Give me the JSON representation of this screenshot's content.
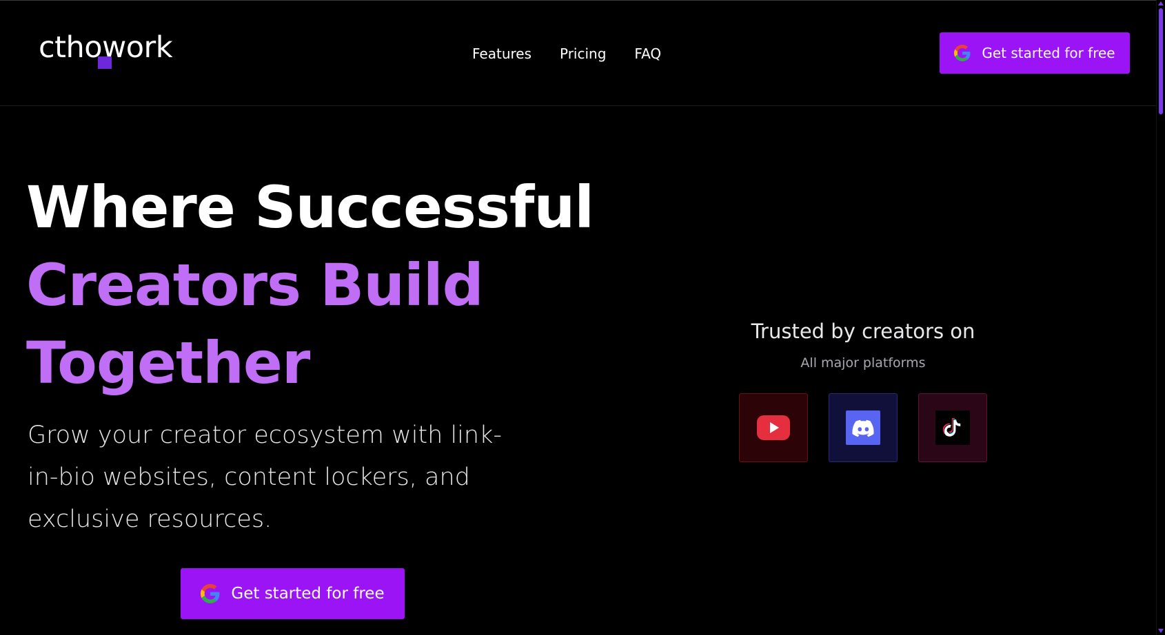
{
  "brand": {
    "logo_text": "cthowork",
    "accent_color": "#9b14f5",
    "highlight_color": "#c06ef5"
  },
  "nav": {
    "items": [
      {
        "label": "Features"
      },
      {
        "label": "Pricing"
      },
      {
        "label": "FAQ"
      }
    ]
  },
  "header": {
    "cta_label": "Get started for free",
    "cta_icon": "google-icon"
  },
  "hero": {
    "title_line1": "Where Successful",
    "title_line2": "Creators Build",
    "title_line3": "Together",
    "subtitle": "Grow your creator ecosystem with link-in-bio websites, content lockers, and exclusive resources.",
    "cta_label": "Get started for free",
    "cta_icon": "google-icon"
  },
  "trusted": {
    "title": "Trusted by creators on",
    "subtitle": "All major platforms",
    "platforms": [
      {
        "icon": "youtube-icon"
      },
      {
        "icon": "discord-icon"
      },
      {
        "icon": "tiktok-icon"
      }
    ]
  }
}
